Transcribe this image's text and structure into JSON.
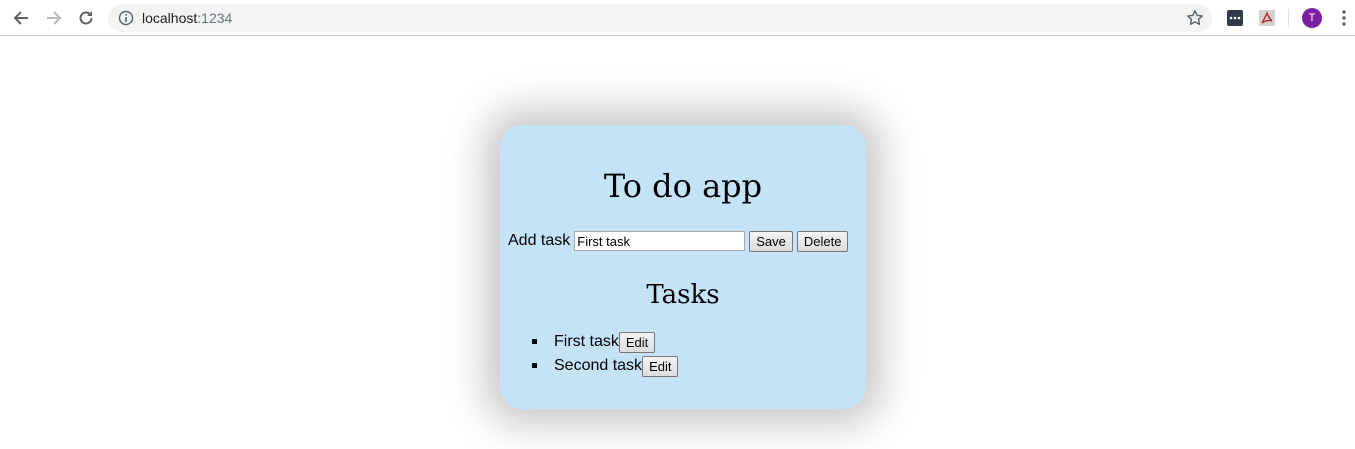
{
  "browser": {
    "url_host": "localhost",
    "url_port": ":1234",
    "avatar_initial": "T",
    "icons": [
      "back-arrow-icon",
      "forward-arrow-icon",
      "reload-icon",
      "info-icon",
      "star-icon",
      "extension-icon",
      "pdf-extension-icon",
      "menu-icon"
    ]
  },
  "app": {
    "title": "To do app",
    "add_label": "Add task",
    "input_value": "First task",
    "save_label": "Save",
    "delete_label": "Delete",
    "tasks_heading": "Tasks",
    "tasks": [
      {
        "text": "First task",
        "edit_label": "Edit"
      },
      {
        "text": "Second task",
        "edit_label": "Edit"
      }
    ]
  },
  "colors": {
    "card_background": "#c5e3f6",
    "avatar_background": "#7b1fa2"
  }
}
